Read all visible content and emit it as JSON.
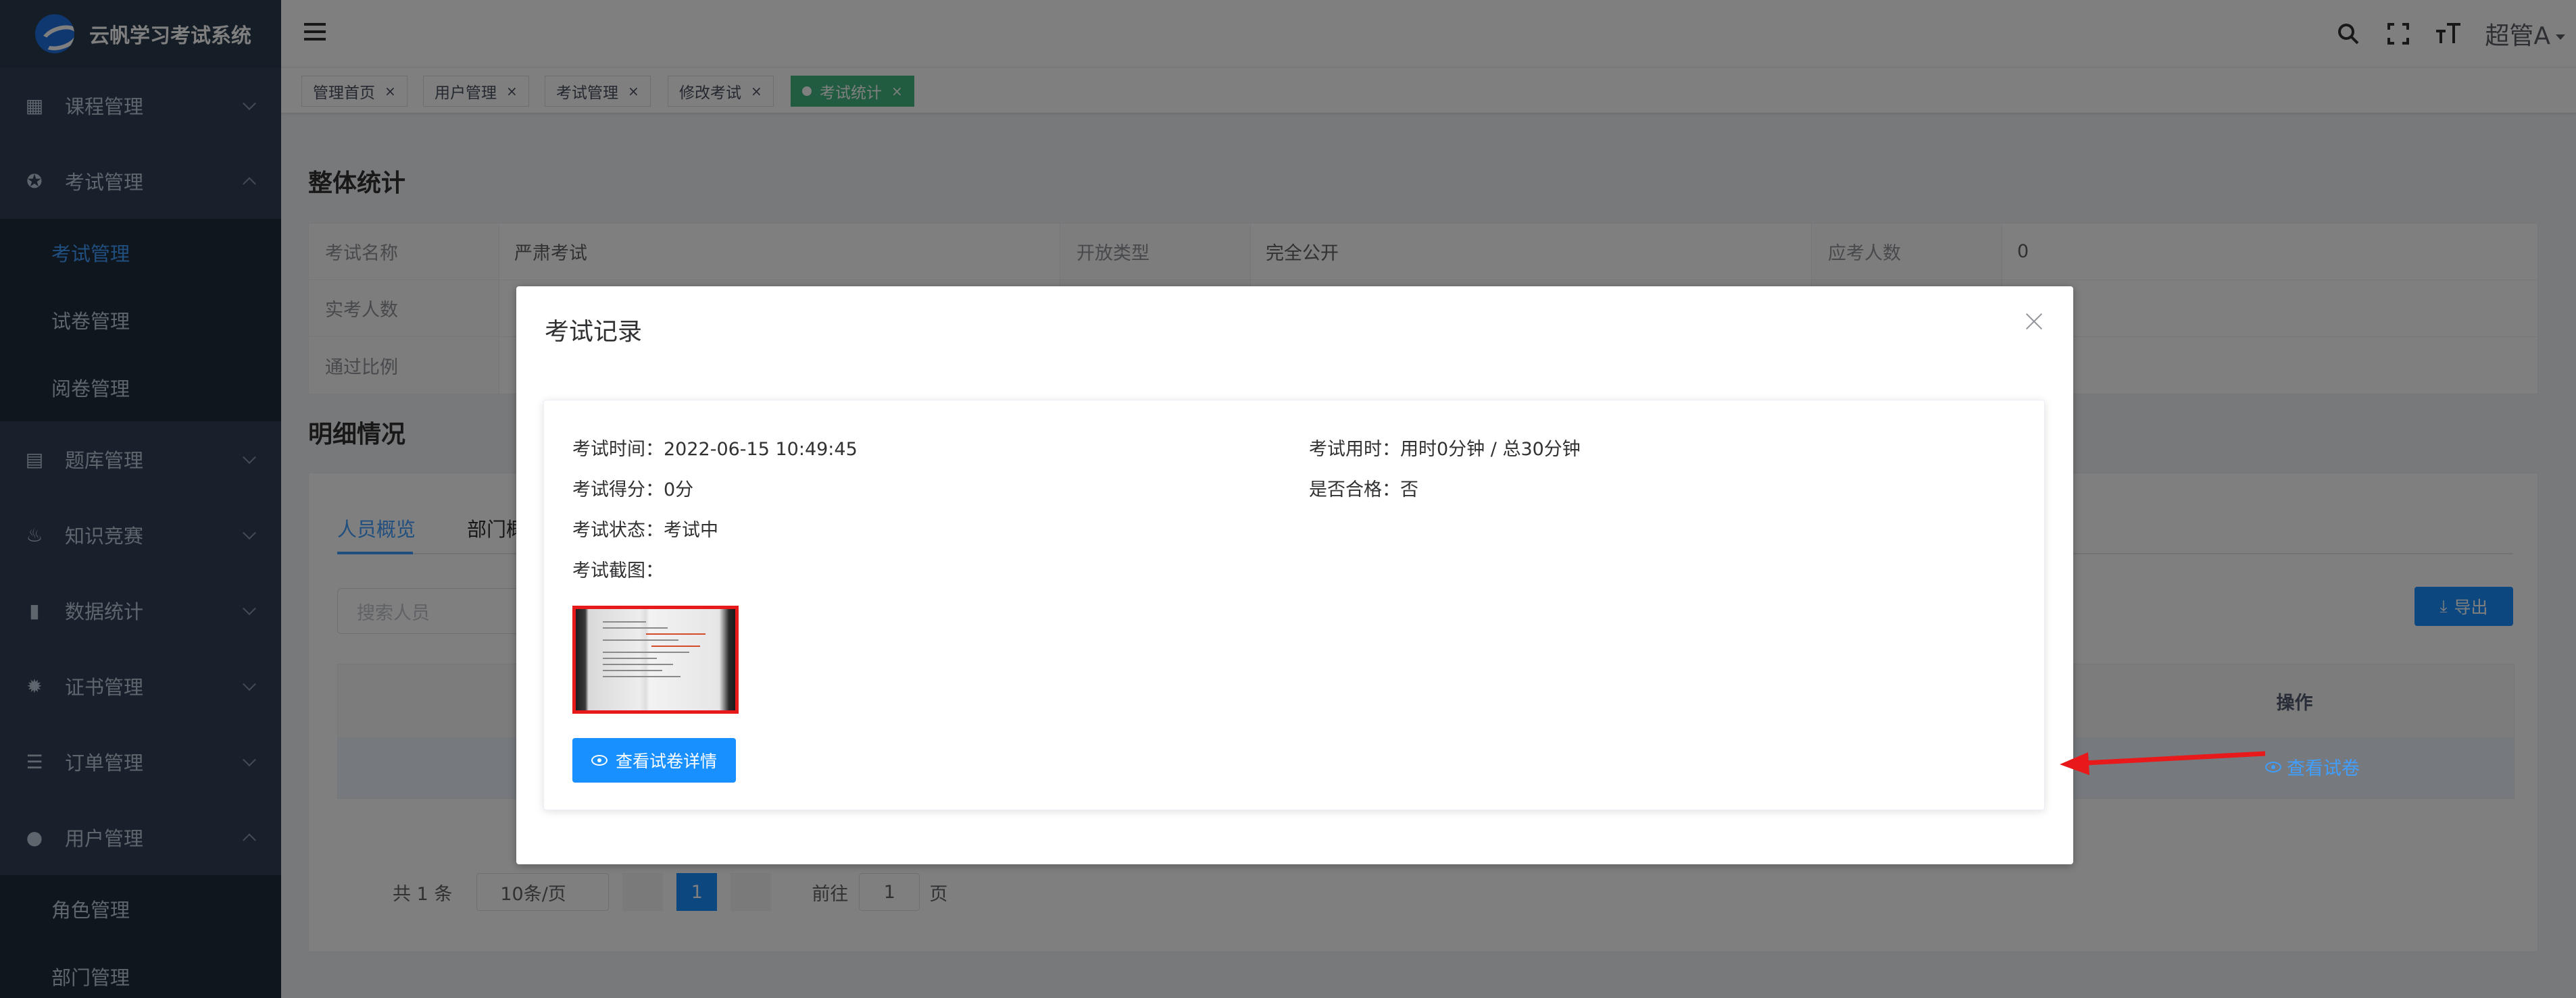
{
  "app": {
    "title": "云帆学习考试系统"
  },
  "sidebar": {
    "items": [
      {
        "label": "课程管理",
        "icon": "course-icon",
        "expanded": false
      },
      {
        "label": "考试管理",
        "icon": "exam-icon",
        "expanded": true,
        "children": [
          "考试管理",
          "试卷管理",
          "阅卷管理"
        ],
        "active_child": "考试管理"
      },
      {
        "label": "题库管理",
        "icon": "question-bank-icon",
        "expanded": false
      },
      {
        "label": "知识竞赛",
        "icon": "fire-icon",
        "expanded": false
      },
      {
        "label": "数据统计",
        "icon": "bar-chart-icon",
        "expanded": false
      },
      {
        "label": "证书管理",
        "icon": "certificate-icon",
        "expanded": false
      },
      {
        "label": "订单管理",
        "icon": "list-icon",
        "expanded": false
      },
      {
        "label": "用户管理",
        "icon": "user-icon",
        "expanded": true,
        "children": [
          "角色管理",
          "部门管理"
        ]
      }
    ]
  },
  "header": {
    "username": "超管A"
  },
  "tags": [
    {
      "label": "管理首页",
      "active": false
    },
    {
      "label": "用户管理",
      "active": false
    },
    {
      "label": "考试管理",
      "active": false
    },
    {
      "label": "修改考试",
      "active": false
    },
    {
      "label": "考试统计",
      "active": true
    }
  ],
  "overall": {
    "title": "整体统计",
    "rows": [
      [
        {
          "label": "考试名称",
          "value": "严肃考试"
        },
        {
          "label": "开放类型",
          "value": "完全公开"
        },
        {
          "label": "应考人数",
          "value": "0"
        }
      ],
      [
        {
          "label": "实考人数",
          "value": ""
        },
        {
          "label": "",
          "value": ""
        },
        {
          "label": "",
          "value": ""
        }
      ],
      [
        {
          "label": "通过比例",
          "value": ""
        },
        {
          "label": "",
          "value": ""
        },
        {
          "label": "",
          "value": ""
        }
      ]
    ]
  },
  "detail": {
    "title": "明细情况",
    "tabs": [
      "人员概览",
      "部门概"
    ],
    "search_placeholder": "搜索人员",
    "export_label": "导出",
    "table": {
      "op_header": "操作",
      "row_action": "查看试卷"
    },
    "pagination": {
      "total": "共 1 条",
      "page_size": "10条/页",
      "current": "1",
      "goto_label": "前往",
      "goto_value": "1",
      "page_suffix": "页"
    }
  },
  "modal": {
    "title": "考试记录",
    "exam_time_label": "考试时间：",
    "exam_time": "2022-06-15 10:49:45",
    "duration_label": "考试用时：",
    "duration": "用时0分钟 / 总30分钟",
    "score_label": "考试得分：",
    "score": "0分",
    "pass_label": "是否合格：",
    "pass": "否",
    "status_label": "考试状态：",
    "status": "考试中",
    "screenshot_label": "考试截图：",
    "view_detail_label": "查看试卷详情"
  },
  "colors": {
    "primary": "#1890ff",
    "sidebar": "#304156",
    "active_tag": "#42b983",
    "annotation": "#e8191b"
  }
}
